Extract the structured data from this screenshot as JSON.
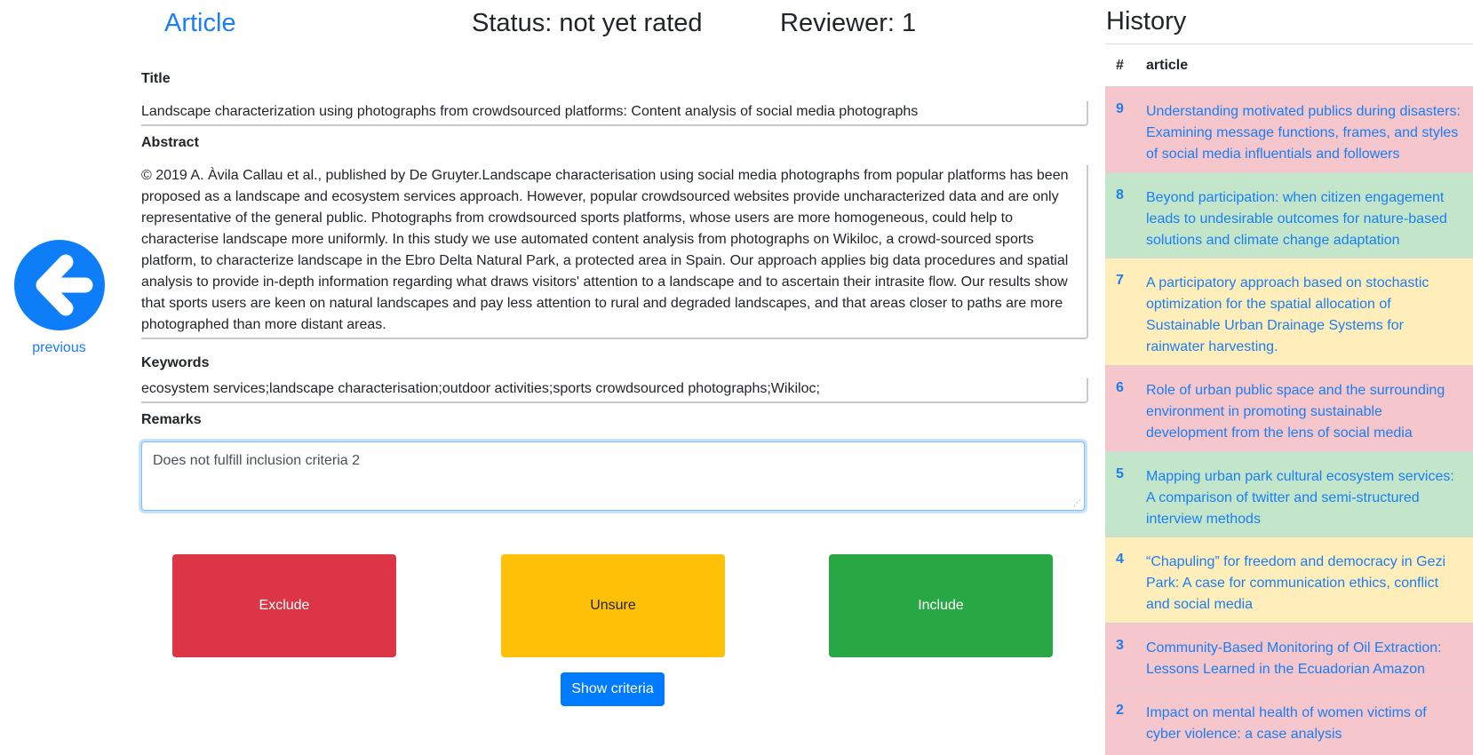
{
  "header": {
    "article_link": "Article",
    "status": "Status: not yet rated",
    "reviewer": "Reviewer: 1"
  },
  "nav": {
    "previous_label": "previous",
    "previous_icon": "arrow-left-circle-icon"
  },
  "form": {
    "title_label": "Title",
    "title_value": "Landscape characterization using photographs from crowdsourced platforms: Content analysis of social media photographs",
    "abstract_label": "Abstract",
    "abstract_value": "© 2019 A. Àvila Callau et al., published by De Gruyter.Landscape characterisation using social media photographs from popular platforms has been proposed as a landscape and ecosystem services approach. However, popular crowdsourced websites provide uncharacterized data and are only representative of the general public. Photographs from crowdsourced sports platforms, whose users are more homogeneous, could help to characterise landscape more uniformly. In this study we use automated content analysis from photographs on Wikiloc, a crowd-sourced sports platform, to characterize landscape in the Ebro Delta Natural Park, a protected area in Spain. Our approach applies big data procedures and spatial analysis to provide in-depth information regarding what draws visitors' attention to a landscape and to ascertain their intrasite flow. Our results show that sports users are keen on natural landscapes and pay less attention to rural and degraded landscapes, and that areas closer to paths are more photographed than more distant areas.",
    "keywords_label": "Keywords",
    "keywords_value": "ecosystem services;landscape characterisation;outdoor activities;sports crowdsourced photographs;Wikiloc;",
    "remarks_label": "Remarks",
    "remarks_value": "Does not fulfill inclusion criteria 2"
  },
  "actions": {
    "exclude": "Exclude",
    "unsure": "Unsure",
    "include": "Include",
    "show_criteria": "Show criteria"
  },
  "colors": {
    "exclude": "#dc3545",
    "unsure": "#ffc107",
    "include": "#28a745",
    "primary": "#007bff",
    "row_excluded": "#f5c6cb",
    "row_included": "#c3e6cb",
    "row_unsure": "#ffeeba"
  },
  "history": {
    "title": "History",
    "col_num": "#",
    "col_article": "article",
    "rows": [
      {
        "num": "9",
        "article": "Understanding motivated publics during disasters: Examining message functions, frames, and styles of social media influentials and followers",
        "status": "pink"
      },
      {
        "num": "8",
        "article": "Beyond participation: when citizen engagement leads to undesirable outcomes for nature-based solutions and climate change adaptation",
        "status": "green"
      },
      {
        "num": "7",
        "article": "A participatory approach based on stochastic optimization for the spatial allocation of Sustainable Urban Drainage Systems for rainwater harvesting.",
        "status": "yellow"
      },
      {
        "num": "6",
        "article": "Role of urban public space and the surrounding environment in promoting sustainable development from the lens of social media",
        "status": "pink"
      },
      {
        "num": "5",
        "article": "Mapping urban park cultural ecosystem services: A comparison of twitter and semi-structured interview methods",
        "status": "green"
      },
      {
        "num": "4",
        "article": "“Chapuling” for freedom and democracy in Gezi Park: A case for communication ethics, conflict and social media",
        "status": "yellow"
      },
      {
        "num": "3",
        "article": "Community-Based Monitoring of Oil Extraction: Lessons Learned in the Ecuadorian Amazon",
        "status": "pink"
      },
      {
        "num": "2",
        "article": "Impact on mental health of women victims of cyber violence: a case analysis",
        "status": "pink"
      }
    ]
  }
}
